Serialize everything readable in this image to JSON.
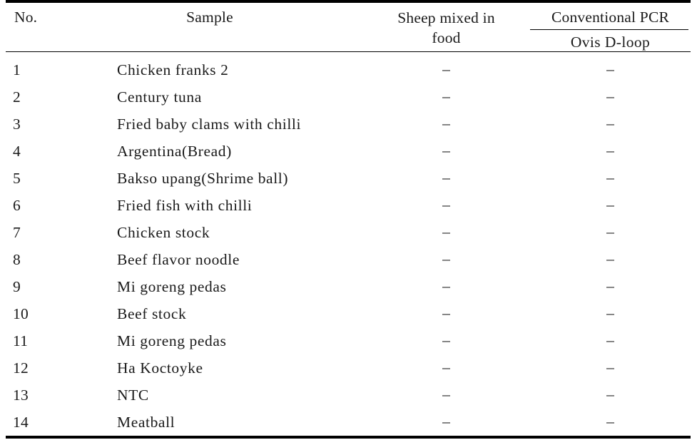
{
  "table": {
    "headers": {
      "no": "No.",
      "sample": "Sample",
      "sheep_mixed_line1": "Sheep mixed in",
      "sheep_mixed_line2": "food",
      "pcr_group": "Conventional PCR",
      "pcr_sub": "Ovis D-loop"
    },
    "rows": [
      {
        "no": "1",
        "sample": "Chicken franks 2",
        "sheep": "–",
        "pcr": "–"
      },
      {
        "no": "2",
        "sample": "Century tuna",
        "sheep": "–",
        "pcr": "–"
      },
      {
        "no": "3",
        "sample": "Fried baby clams with chilli",
        "sheep": "–",
        "pcr": "–"
      },
      {
        "no": "4",
        "sample": "Argentina(Bread)",
        "sheep": "–",
        "pcr": "–"
      },
      {
        "no": "5",
        "sample": "Bakso upang(Shrime ball)",
        "sheep": "–",
        "pcr": "–"
      },
      {
        "no": "6",
        "sample": "Fried fish with chilli",
        "sheep": "–",
        "pcr": "–"
      },
      {
        "no": "7",
        "sample": "Chicken stock",
        "sheep": "–",
        "pcr": "–"
      },
      {
        "no": "8",
        "sample": "Beef flavor noodle",
        "sheep": "–",
        "pcr": "–"
      },
      {
        "no": "9",
        "sample": "Mi goreng pedas",
        "sheep": "–",
        "pcr": "–"
      },
      {
        "no": "10",
        "sample": "Beef stock",
        "sheep": "–",
        "pcr": "–"
      },
      {
        "no": "11",
        "sample": "Mi goreng pedas",
        "sheep": "–",
        "pcr": "–"
      },
      {
        "no": "12",
        "sample": "Ha Koctoyke",
        "sheep": "–",
        "pcr": "–"
      },
      {
        "no": "13",
        "sample": "NTC",
        "sheep": "–",
        "pcr": "–"
      },
      {
        "no": "14",
        "sample": "Meatball",
        "sheep": "–",
        "pcr": "–"
      }
    ]
  },
  "colors": {
    "rule": "#000000",
    "text": "#1a1a1a",
    "background": "#ffffff"
  }
}
